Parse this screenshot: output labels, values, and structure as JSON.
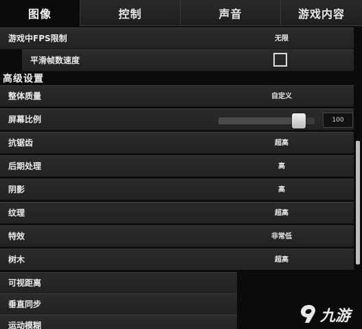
{
  "tabs": [
    {
      "label": "图像"
    },
    {
      "label": "控制"
    },
    {
      "label": "声音"
    },
    {
      "label": "游戏内容"
    }
  ],
  "rows": {
    "fps_limit": {
      "label": "游戏中FPS限制",
      "value": "无限"
    },
    "smooth_fps": {
      "label": "平滑帧数速度",
      "checked": false
    },
    "section_title": "高级设置",
    "overall_quality": {
      "label": "整体质量",
      "value": "自定义"
    },
    "screen_ratio": {
      "label": "屏幕比例",
      "value": "100",
      "slider_percent": 100,
      "slider_max": 120
    },
    "antialiasing": {
      "label": "抗锯齿",
      "value": "超高"
    },
    "post_processing": {
      "label": "后期处理",
      "value": "高"
    },
    "shadows": {
      "label": "阴影",
      "value": "高"
    },
    "textures": {
      "label": "纹理",
      "value": "超高"
    },
    "effects": {
      "label": "特效",
      "value": "非常低"
    },
    "trees": {
      "label": "树木",
      "value": "超高"
    },
    "view_distance": {
      "label": "可视距离"
    },
    "vsync": {
      "label": "垂直同步"
    },
    "motion_blur": {
      "label": "运动模糊"
    }
  },
  "watermark": {
    "text": "九游",
    "icon": "9game-logo-icon"
  }
}
